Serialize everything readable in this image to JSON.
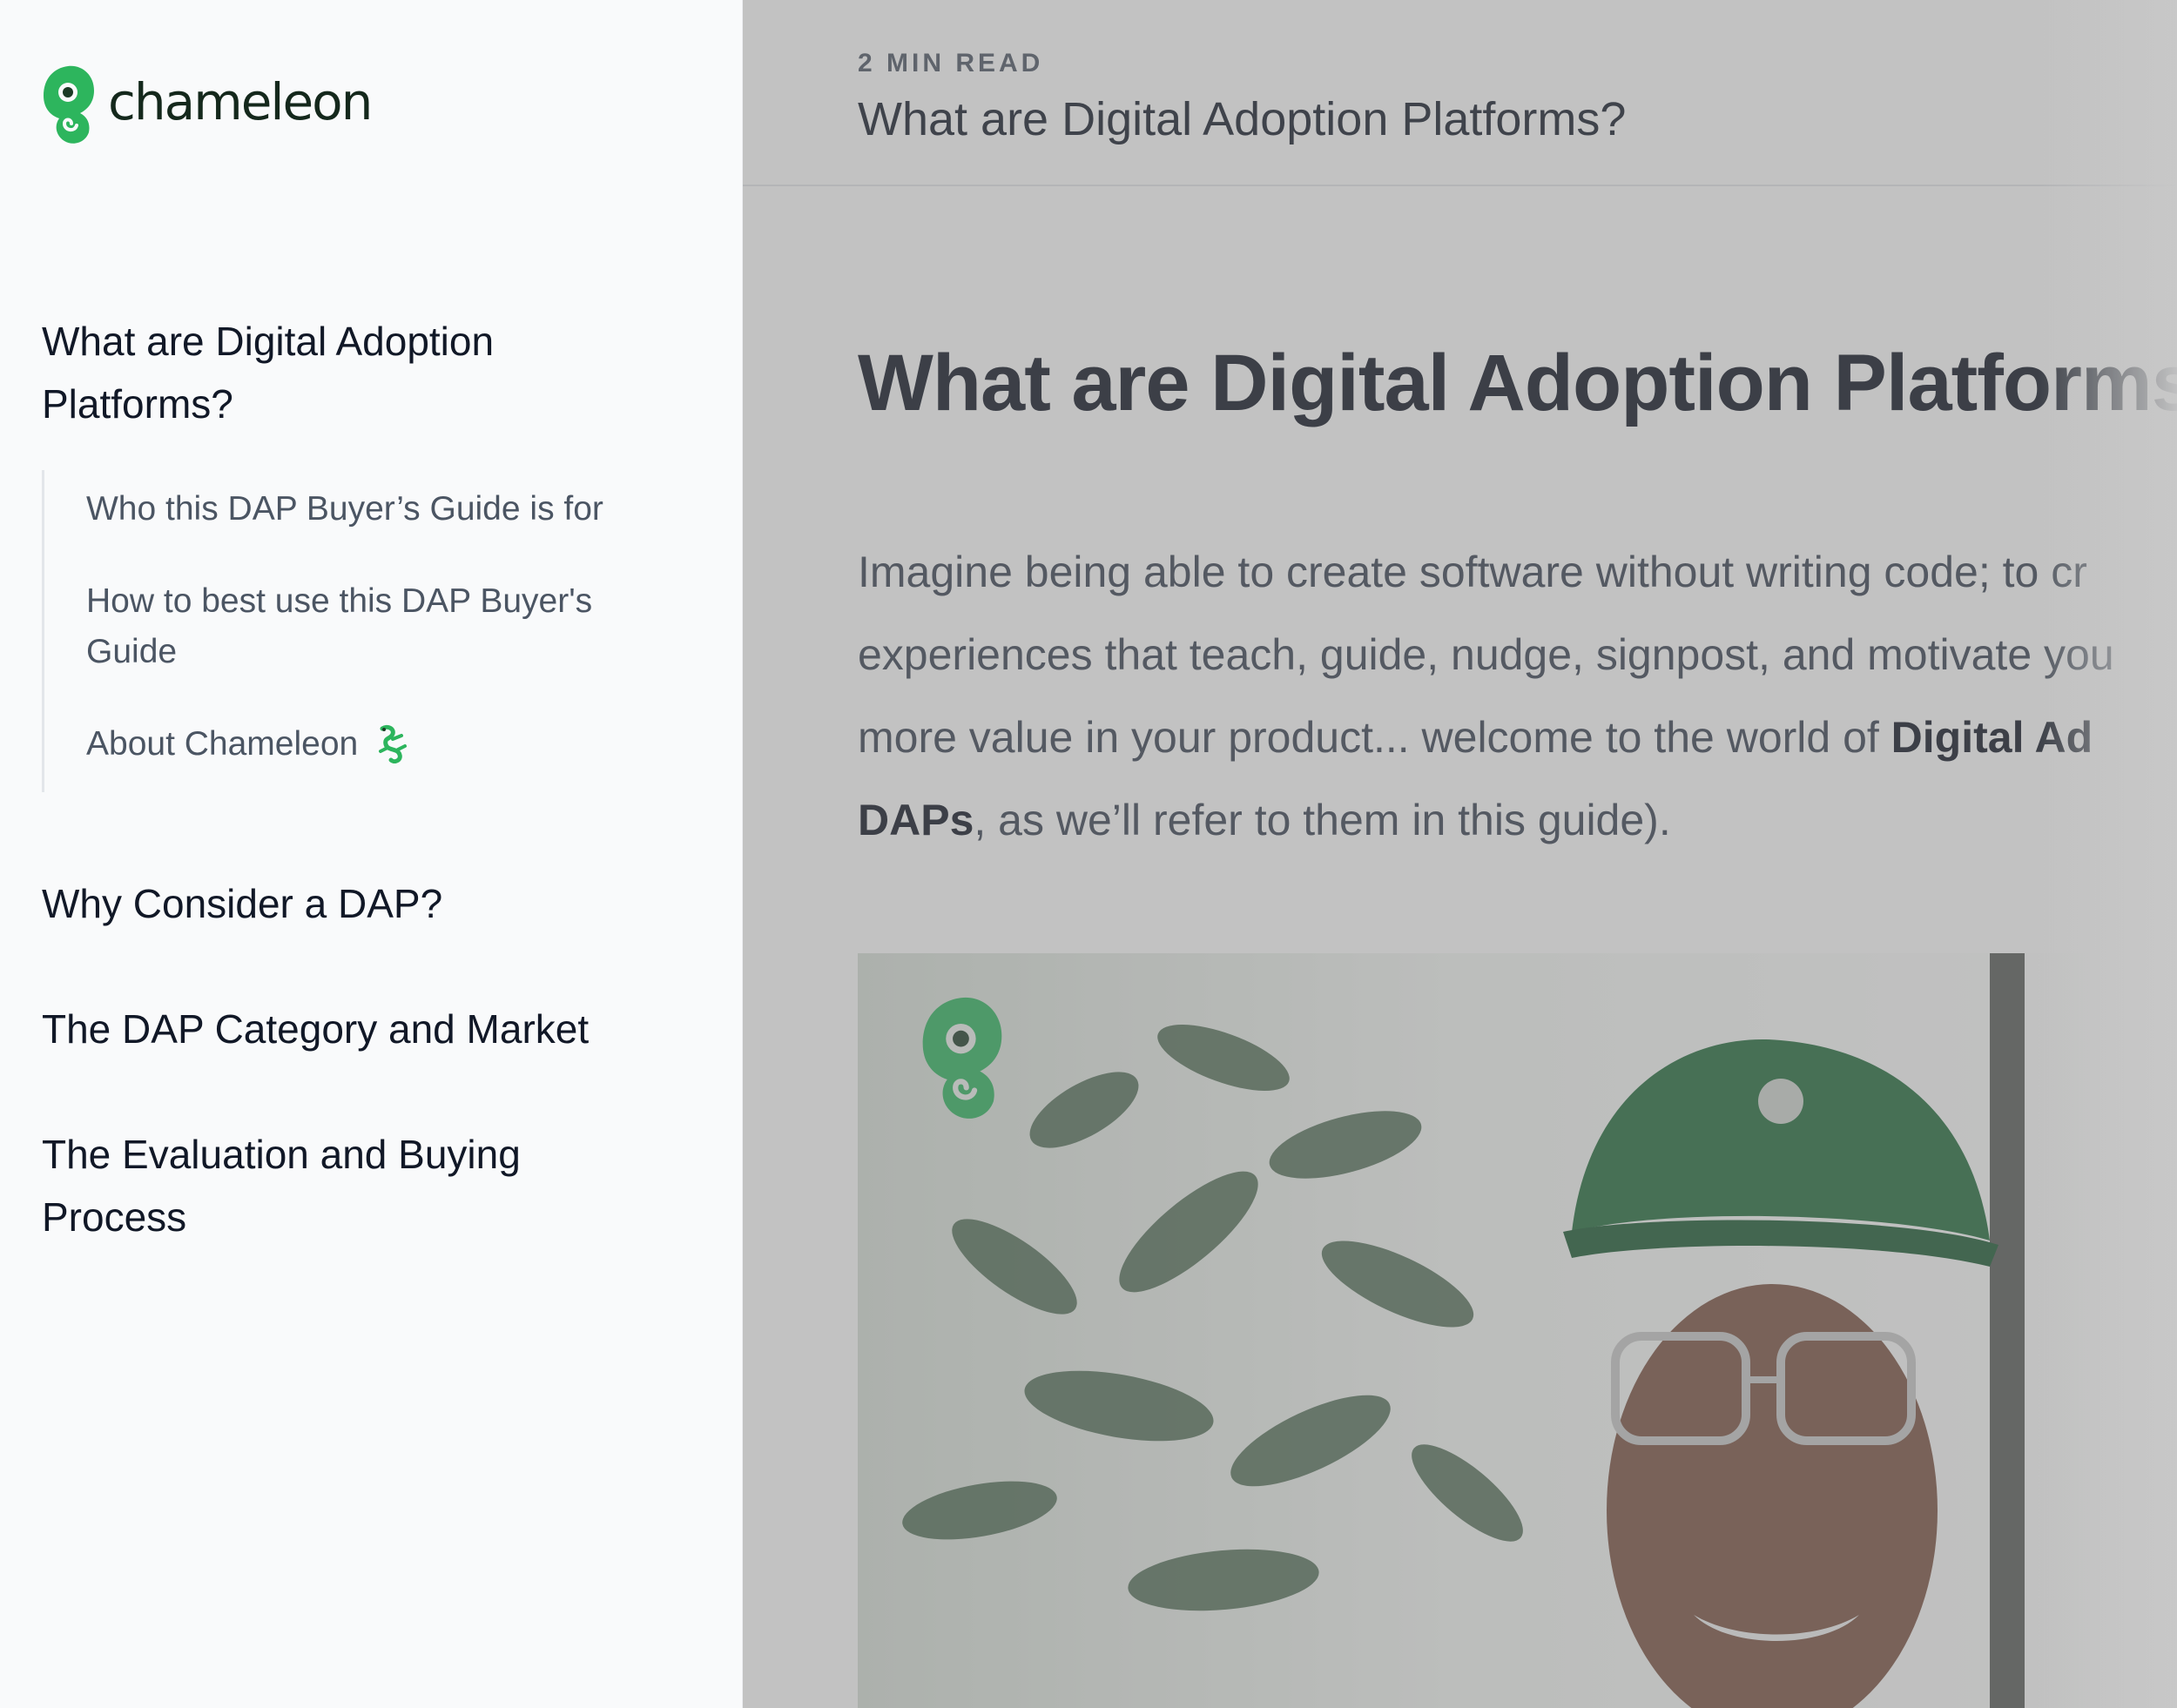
{
  "brand": {
    "name": "chameleon",
    "accent": "#2db55d",
    "dark_green": "#1f6b3a",
    "icon": "chameleon-logo-icon"
  },
  "sidebar": {
    "sections": [
      {
        "label": "What are Digital Adoption Platforms?",
        "subitems": [
          {
            "label": "Who this DAP Buyer’s Guide is for"
          },
          {
            "label": "How to best use this DAP Buyer's Guide"
          },
          {
            "label": "About Chameleon",
            "icon": "lizard-icon"
          }
        ]
      },
      {
        "label": "Why Consider a DAP?"
      },
      {
        "label": "The DAP Category and Market"
      },
      {
        "label": "The Evaluation and Buying Process"
      }
    ]
  },
  "header": {
    "read_time": "2 MIN READ",
    "title": "What are Digital Adoption Platforms?"
  },
  "article": {
    "headline": "What are Digital Adoption Platforms?",
    "intro": {
      "l1": "Imagine being able to create software without writing code; to cr",
      "l2": "experiences that teach, guide, nudge, signpost, and motivate you",
      "l3_pre": "more value in your product... welcome to the world of ",
      "l3_bold": "Digital Ad",
      "l4_bold": "DAPs",
      "l4_post": ", as we’ll refer to them in this guide)."
    },
    "video": {
      "icon": "chameleon-logo-icon"
    }
  }
}
